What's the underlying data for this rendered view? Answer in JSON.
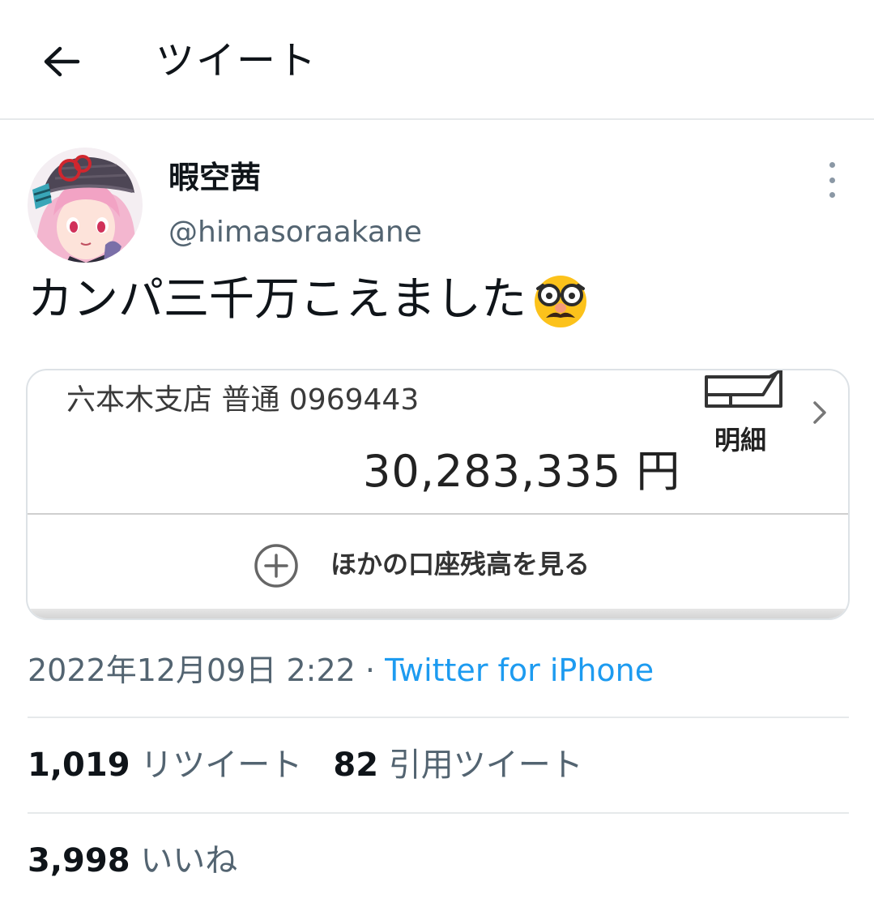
{
  "header": {
    "title": "ツイート"
  },
  "tweet": {
    "display_name": "暇空茜",
    "handle": "@himasoraakane",
    "text": "カンパ三千万こえました",
    "emoji": "disguised-face",
    "timestamp": "2022年12月09日 2:22",
    "separator": " · ",
    "source": "Twitter for iPhone"
  },
  "media": {
    "branch_line": "六本木支店 普通 0969443",
    "balance": "30,283,335 円",
    "detail_label": "明細",
    "other_accounts_label": "ほかの口座残高を見る"
  },
  "stats": {
    "retweets_count": "1,019",
    "retweets_label": "リツイート",
    "quotes_count": "82",
    "quotes_label": "引用ツイート",
    "likes_count": "3,998",
    "likes_label": "いいね"
  },
  "colors": {
    "accent": "#1d9bf0",
    "secondary_text": "#536471",
    "primary_text": "#0f1419",
    "divider": "#e6e9eb"
  }
}
